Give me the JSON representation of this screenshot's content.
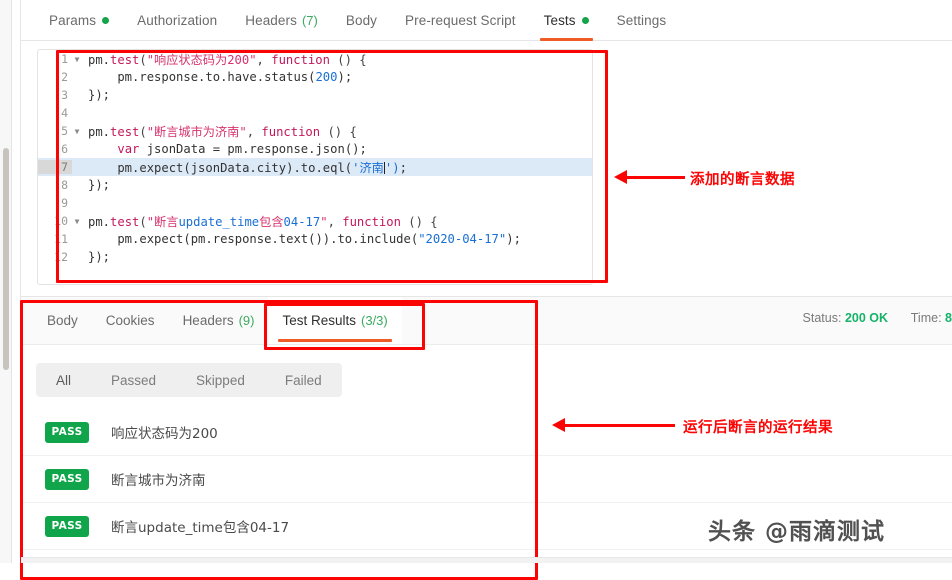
{
  "request_tabs": [
    {
      "label": "Params",
      "dot": true,
      "count": null,
      "active": false
    },
    {
      "label": "Authorization",
      "dot": false,
      "count": null,
      "active": false
    },
    {
      "label": "Headers",
      "dot": false,
      "count": "(7)",
      "active": false
    },
    {
      "label": "Body",
      "dot": false,
      "count": null,
      "active": false
    },
    {
      "label": "Pre-request Script",
      "dot": false,
      "count": null,
      "active": false
    },
    {
      "label": "Tests",
      "dot": true,
      "count": null,
      "active": true
    },
    {
      "label": "Settings",
      "dot": false,
      "count": null,
      "active": false
    }
  ],
  "editor": {
    "lines": [
      {
        "num": "1",
        "fold": true,
        "highlight": false,
        "tokens": [
          {
            "t": "pm.",
            "c": "t-pm"
          },
          {
            "t": "test",
            "c": "t-fn"
          },
          {
            "t": "(",
            "c": "t-punc"
          },
          {
            "t": "\"响应状态码为",
            "c": "t-str"
          },
          {
            "t": "200",
            "c": "t-str"
          },
          {
            "t": "\"",
            "c": "t-str"
          },
          {
            "t": ", ",
            "c": "t-punc"
          },
          {
            "t": "function",
            "c": "t-kw"
          },
          {
            "t": " () {",
            "c": "t-punc"
          }
        ]
      },
      {
        "num": "2",
        "fold": false,
        "highlight": false,
        "tokens": [
          {
            "t": "    pm.response.to.have.status(",
            "c": "t-plain"
          },
          {
            "t": "200",
            "c": "t-num"
          },
          {
            "t": ");",
            "c": "t-plain"
          }
        ]
      },
      {
        "num": "3",
        "fold": false,
        "highlight": false,
        "tokens": [
          {
            "t": "});",
            "c": "t-plain"
          }
        ]
      },
      {
        "num": "4",
        "fold": false,
        "highlight": false,
        "tokens": []
      },
      {
        "num": "5",
        "fold": true,
        "highlight": false,
        "tokens": [
          {
            "t": "pm.",
            "c": "t-pm"
          },
          {
            "t": "test",
            "c": "t-fn"
          },
          {
            "t": "(",
            "c": "t-punc"
          },
          {
            "t": "\"断言城市为济南\"",
            "c": "t-str"
          },
          {
            "t": ", ",
            "c": "t-punc"
          },
          {
            "t": "function",
            "c": "t-kw"
          },
          {
            "t": " () {",
            "c": "t-punc"
          }
        ]
      },
      {
        "num": "6",
        "fold": false,
        "highlight": false,
        "tokens": [
          {
            "t": "    ",
            "c": "t-plain"
          },
          {
            "t": "var",
            "c": "t-kw"
          },
          {
            "t": " jsonData = pm.response.json();",
            "c": "t-plain"
          }
        ]
      },
      {
        "num": "7",
        "fold": false,
        "highlight": true,
        "tokens": [
          {
            "t": "    pm.expect(jsonData.city).to.eql(",
            "c": "t-plain"
          },
          {
            "t": "'济南",
            "c": "t-str2"
          },
          {
            "t": "|",
            "c": "caret-tok"
          },
          {
            "t": "')",
            "c": "t-str2"
          },
          {
            "t": ";",
            "c": "t-plain"
          }
        ]
      },
      {
        "num": "8",
        "fold": false,
        "highlight": false,
        "tokens": [
          {
            "t": "});",
            "c": "t-plain"
          }
        ]
      },
      {
        "num": "9",
        "fold": false,
        "highlight": false,
        "tokens": []
      },
      {
        "num": "10",
        "fold": true,
        "highlight": false,
        "tokens": [
          {
            "t": "pm.",
            "c": "t-pm"
          },
          {
            "t": "test",
            "c": "t-fn"
          },
          {
            "t": "(",
            "c": "t-punc"
          },
          {
            "t": "\"断言",
            "c": "t-str"
          },
          {
            "t": "update_time",
            "c": "t-str2"
          },
          {
            "t": "包含",
            "c": "t-str"
          },
          {
            "t": "04-17",
            "c": "t-str2"
          },
          {
            "t": "\"",
            "c": "t-str"
          },
          {
            "t": ", ",
            "c": "t-punc"
          },
          {
            "t": "function",
            "c": "t-kw"
          },
          {
            "t": " () {",
            "c": "t-punc"
          }
        ]
      },
      {
        "num": "11",
        "fold": false,
        "highlight": false,
        "tokens": [
          {
            "t": "    pm.expect(pm.response.text()).to.include(",
            "c": "t-plain"
          },
          {
            "t": "\"2020-04-17\"",
            "c": "t-str2"
          },
          {
            "t": ");",
            "c": "t-plain"
          }
        ]
      },
      {
        "num": "12",
        "fold": false,
        "highlight": false,
        "tokens": [
          {
            "t": "});",
            "c": "t-plain"
          }
        ]
      }
    ]
  },
  "annotations": [
    {
      "name": "code-annotation",
      "text": "添加的断言数据",
      "color": "#fb0404"
    },
    {
      "name": "results-annotation",
      "text": "运行后断言的运行结果",
      "color": "#fb0404"
    }
  ],
  "response_tabs": [
    {
      "label": "Body",
      "count": null,
      "active": false
    },
    {
      "label": "Cookies",
      "count": null,
      "active": false
    },
    {
      "label": "Headers",
      "count": "(9)",
      "active": false
    },
    {
      "label": "Test Results",
      "count": "(3/3)",
      "active": true
    }
  ],
  "response_meta": {
    "status_label": "Status:",
    "status_value": "200 OK",
    "time_label": "Time:",
    "time_value": "8"
  },
  "filters": [
    {
      "label": "All",
      "active": true
    },
    {
      "label": "Passed",
      "active": false
    },
    {
      "label": "Skipped",
      "active": false
    },
    {
      "label": "Failed",
      "active": false
    }
  ],
  "test_results": [
    {
      "status": "PASS",
      "name": "响应状态码为200"
    },
    {
      "status": "PASS",
      "name": "断言城市为济南"
    },
    {
      "status": "PASS",
      "name": "断言update_time包含04-17"
    }
  ],
  "watermark": {
    "text": "头条 @雨滴测试"
  },
  "colors": {
    "accent_orange": "#ef5b25",
    "pass_green": "#10a54a",
    "annotation_red": "#fb0404",
    "count_green": "#3bab61"
  }
}
